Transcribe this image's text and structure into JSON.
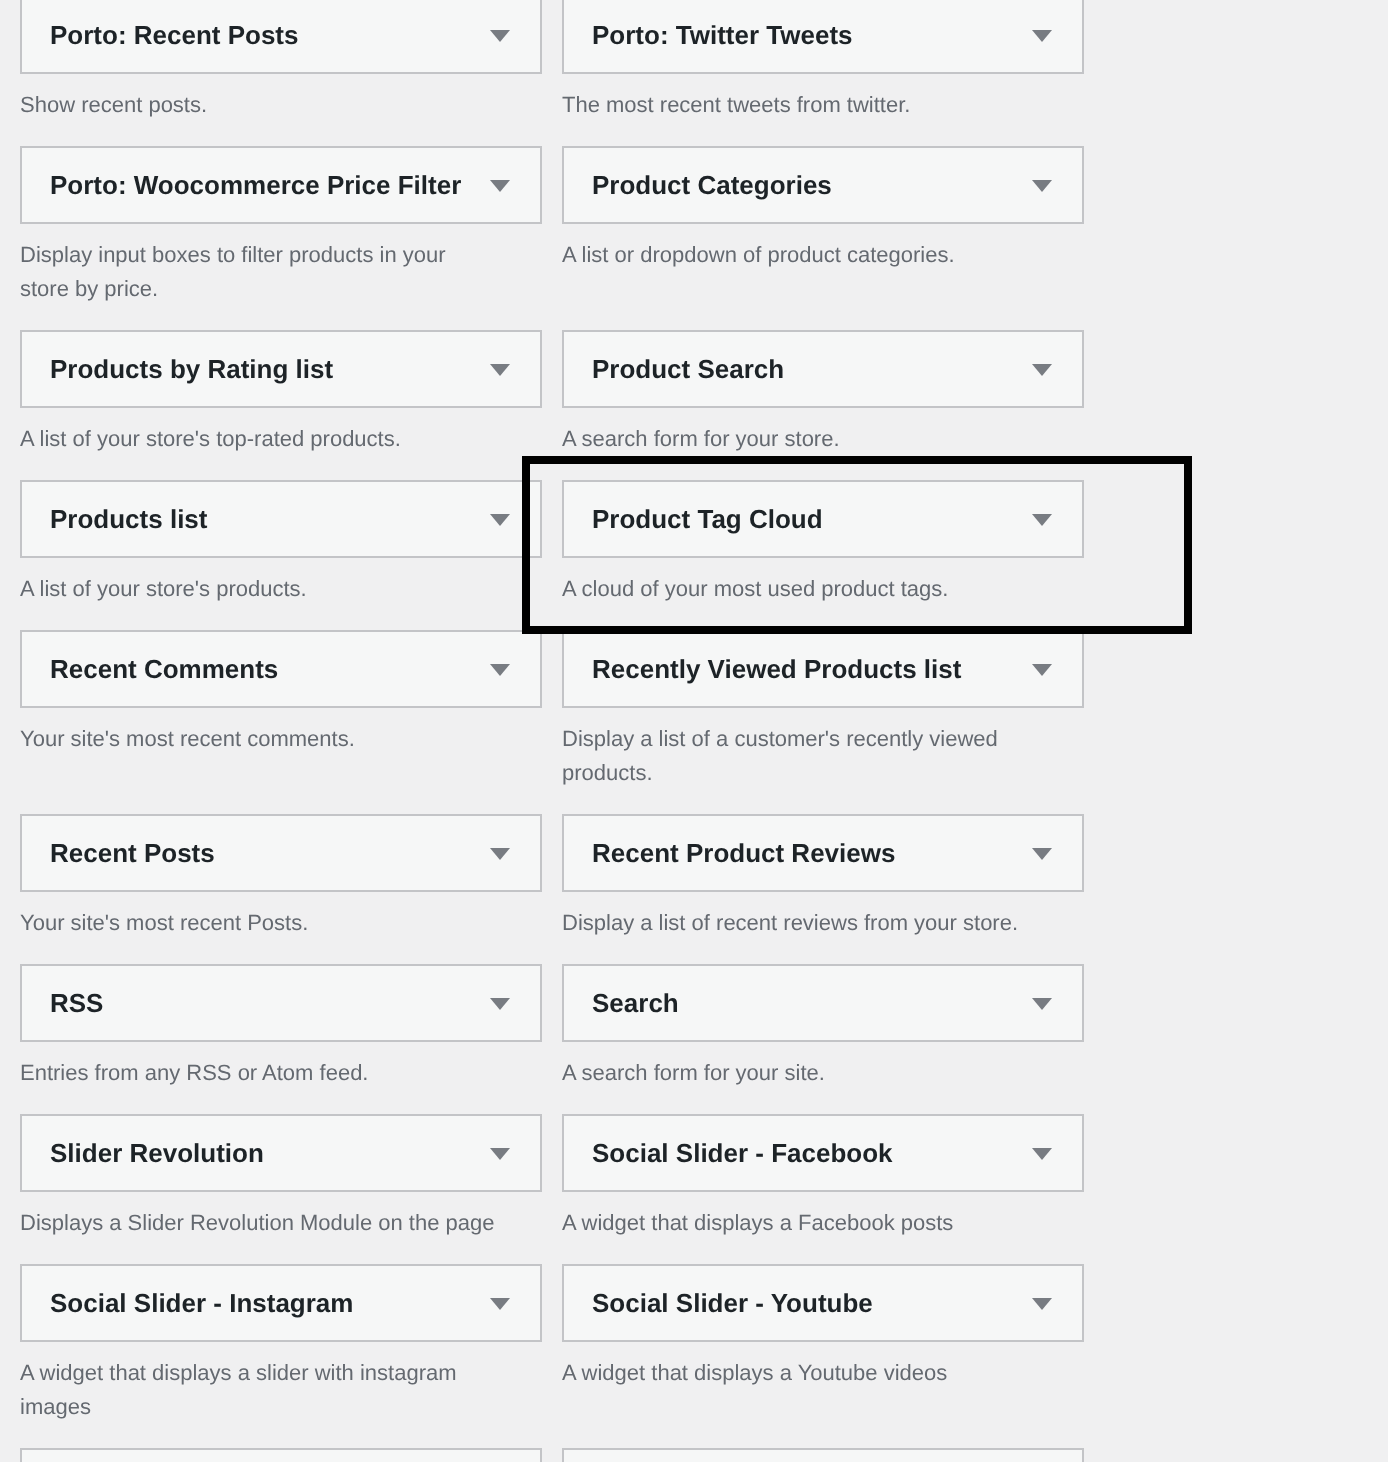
{
  "widgets": [
    {
      "title": "Porto: Recent Posts",
      "description": "Show recent posts."
    },
    {
      "title": "Porto: Twitter Tweets",
      "description": "The most recent tweets from twitter."
    },
    {
      "title": "Porto: Woocommerce Price Filter",
      "description": "Display input boxes to filter products in your store by price."
    },
    {
      "title": "Product Categories",
      "description": "A list or dropdown of product categories."
    },
    {
      "title": "Products by Rating list",
      "description": "A list of your store's top-rated products."
    },
    {
      "title": "Product Search",
      "description": "A search form for your store."
    },
    {
      "title": "Products list",
      "description": "A list of your store's products."
    },
    {
      "title": "Product Tag Cloud",
      "description": "A cloud of your most used product tags."
    },
    {
      "title": "Recent Comments",
      "description": "Your site's most recent comments."
    },
    {
      "title": "Recently Viewed Products list",
      "description": "Display a list of a customer's recently viewed products."
    },
    {
      "title": "Recent Posts",
      "description": "Your site's most recent Posts."
    },
    {
      "title": "Recent Product Reviews",
      "description": "Display a list of recent reviews from your store."
    },
    {
      "title": "RSS",
      "description": "Entries from any RSS or Atom feed."
    },
    {
      "title": "Search",
      "description": "A search form for your site."
    },
    {
      "title": "Slider Revolution",
      "description": "Displays a Slider Revolution Module on the page"
    },
    {
      "title": "Social Slider - Facebook",
      "description": "A widget that displays a Facebook posts"
    },
    {
      "title": "Social Slider - Instagram",
      "description": "A widget that displays a slider with instagram images"
    },
    {
      "title": "Social Slider - Youtube",
      "description": "A widget that displays a Youtube videos"
    }
  ]
}
